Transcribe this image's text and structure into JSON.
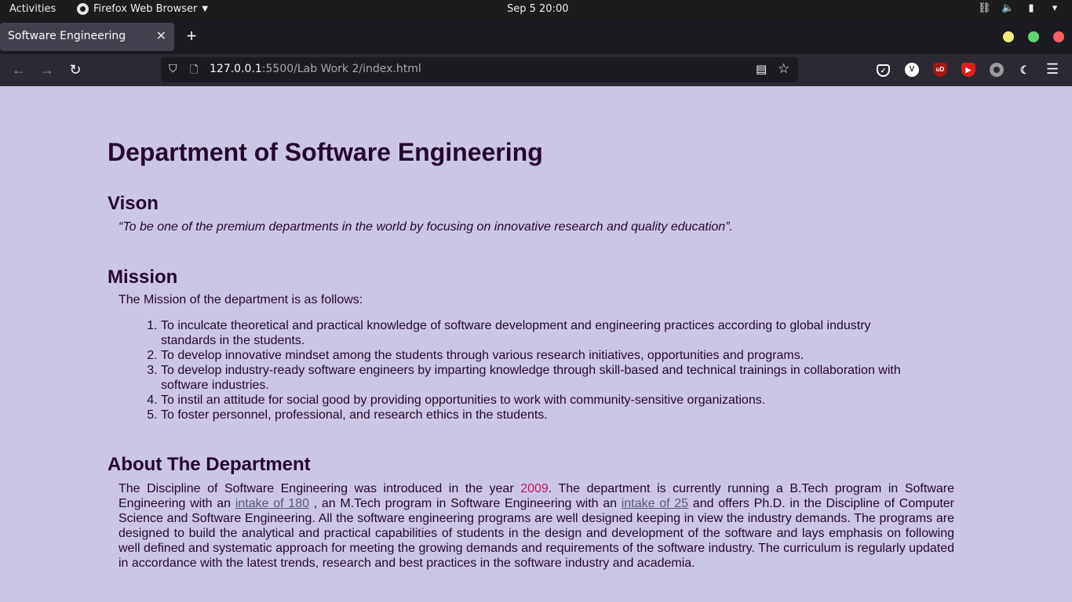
{
  "topbar": {
    "activities": "Activities",
    "app_name": "Firefox Web Browser",
    "clock": "Sep 5  20:00",
    "tray_icons": [
      "network-icon",
      "volume-icon",
      "battery-icon",
      "power-menu-icon"
    ]
  },
  "browser": {
    "tab": {
      "title": "Software Engineering"
    },
    "url": {
      "host": "127.0.0.1",
      "rest": ":5500/Lab Work 2/index.html"
    },
    "window_buttons": {
      "minimize": "#f4ec7a",
      "maximize": "#5fd86b",
      "close": "#f95f5f"
    },
    "extensions": [
      "pocket-icon",
      "vimium-icon",
      "ublock-icon",
      "youtube-icon",
      "circle-extension-icon",
      "dark-reader-icon"
    ]
  },
  "page": {
    "background": "#cbc6e6",
    "text_color": "#26072c",
    "heading": "Department of Software Engineering",
    "vision": {
      "title": "Vison",
      "quote": "“To be one of the premium departments in the world by focusing on innovative research and quality education”."
    },
    "mission": {
      "title": "Mission",
      "intro": "The Mission of the department is as follows:",
      "items": [
        "To inculcate theoretical and practical knowledge of software development and engineering practices according to global industry standards in the students.",
        "To develop innovative mindset among the students through various research initiatives, opportunities and programs.",
        "To develop industry-ready software engineers by imparting knowledge through skill-based and technical trainings in collaboration with software industries.",
        "To instil an attitude for social good by providing opportunities to work with community-sensitive organizations.",
        "To foster personnel, professional, and research ethics in the students."
      ]
    },
    "about": {
      "title": "About The Department",
      "p1": "The Discipline of Software Engineering was introduced in the year ",
      "year": "2009",
      "p2": ". The department is currently running a B.Tech program in Software Engineering with an ",
      "intake1": "intake of 180",
      "p3": " , an M.Tech program in Software Engineering with an ",
      "intake2": "intake of 25",
      "p4": " and offers Ph.D. in the Discipline of Computer Science and Software Engineering. All the software engineering programs are well designed keeping in view the industry demands. The programs are designed to build the analytical and practical capabilities of students in the design and development of the software and lays emphasis on following well defined and systematic approach for meeting the growing demands and requirements of the software industry. The curriculum is regularly updated in accordance with the latest trends, research and best practices in the software industry and academia.",
      "year_color": "#c2185b",
      "link_color": "#555a73"
    }
  }
}
